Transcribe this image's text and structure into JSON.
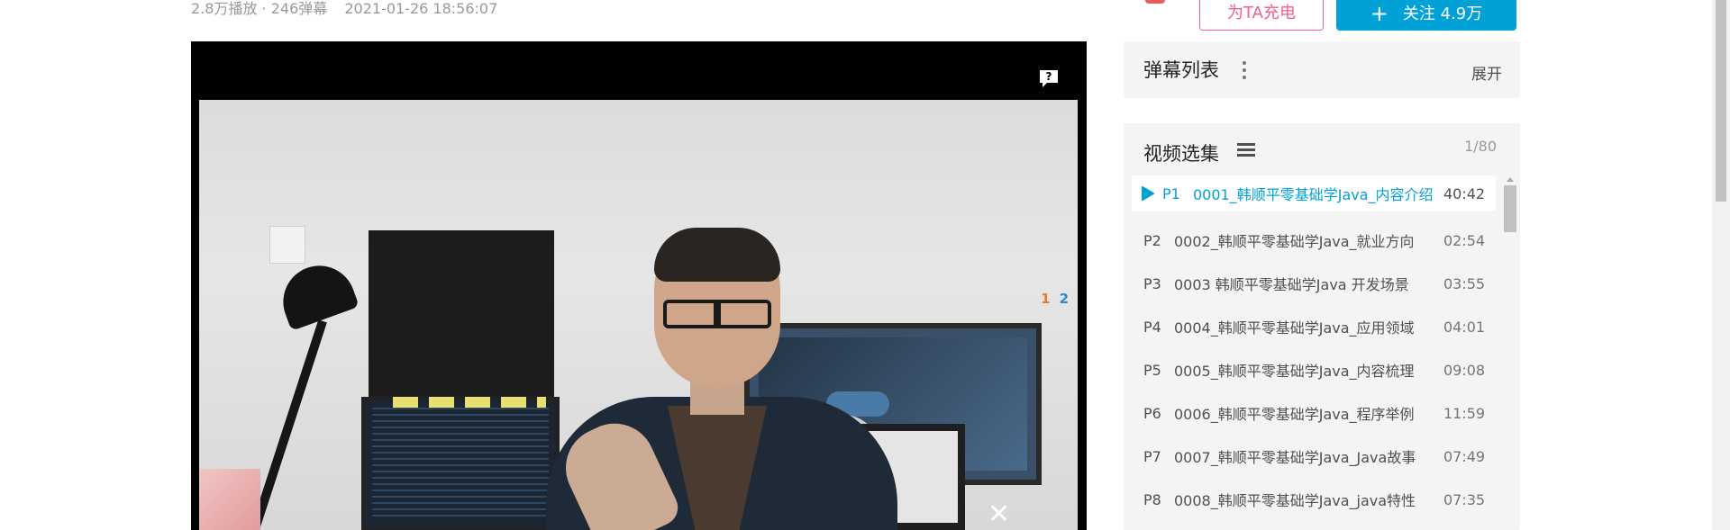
{
  "video_meta": {
    "plays": "2.8万播放 · 246弹幕",
    "date": "2021-01-26 18:56:07"
  },
  "player": {
    "help_icon": "question-bubble-icon",
    "badge_left": "1",
    "badge_right": "2"
  },
  "actions": {
    "charge_label": "为TA充电",
    "follow_label": "关注 4.9万",
    "accent_color": "#00a1d6",
    "charge_color": "#f25d8e"
  },
  "danmaku": {
    "title": "弹幕列表",
    "expand_label": "展开"
  },
  "episodes": {
    "title": "视频选集",
    "page_count": "1/80",
    "items": [
      {
        "num": "P1",
        "name": "0001_韩顺平零基础学Java_内容介绍",
        "duration": "40:42",
        "active": true
      },
      {
        "num": "P2",
        "name": "0002_韩顺平零基础学Java_就业方向",
        "duration": "02:54"
      },
      {
        "num": "P3",
        "name": "0003 韩顺平零基础学Java 开发场景",
        "duration": "03:55"
      },
      {
        "num": "P4",
        "name": "0004_韩顺平零基础学Java_应用领域",
        "duration": "04:01"
      },
      {
        "num": "P5",
        "name": "0005_韩顺平零基础学Java_内容梳理",
        "duration": "09:08"
      },
      {
        "num": "P6",
        "name": "0006_韩顺平零基础学Java_程序举例",
        "duration": "11:59"
      },
      {
        "num": "P7",
        "name": "0007_韩顺平零基础学Java_Java故事",
        "duration": "07:49"
      },
      {
        "num": "P8",
        "name": "0008_韩顺平零基础学Java_java特性",
        "duration": "07:35"
      }
    ]
  }
}
